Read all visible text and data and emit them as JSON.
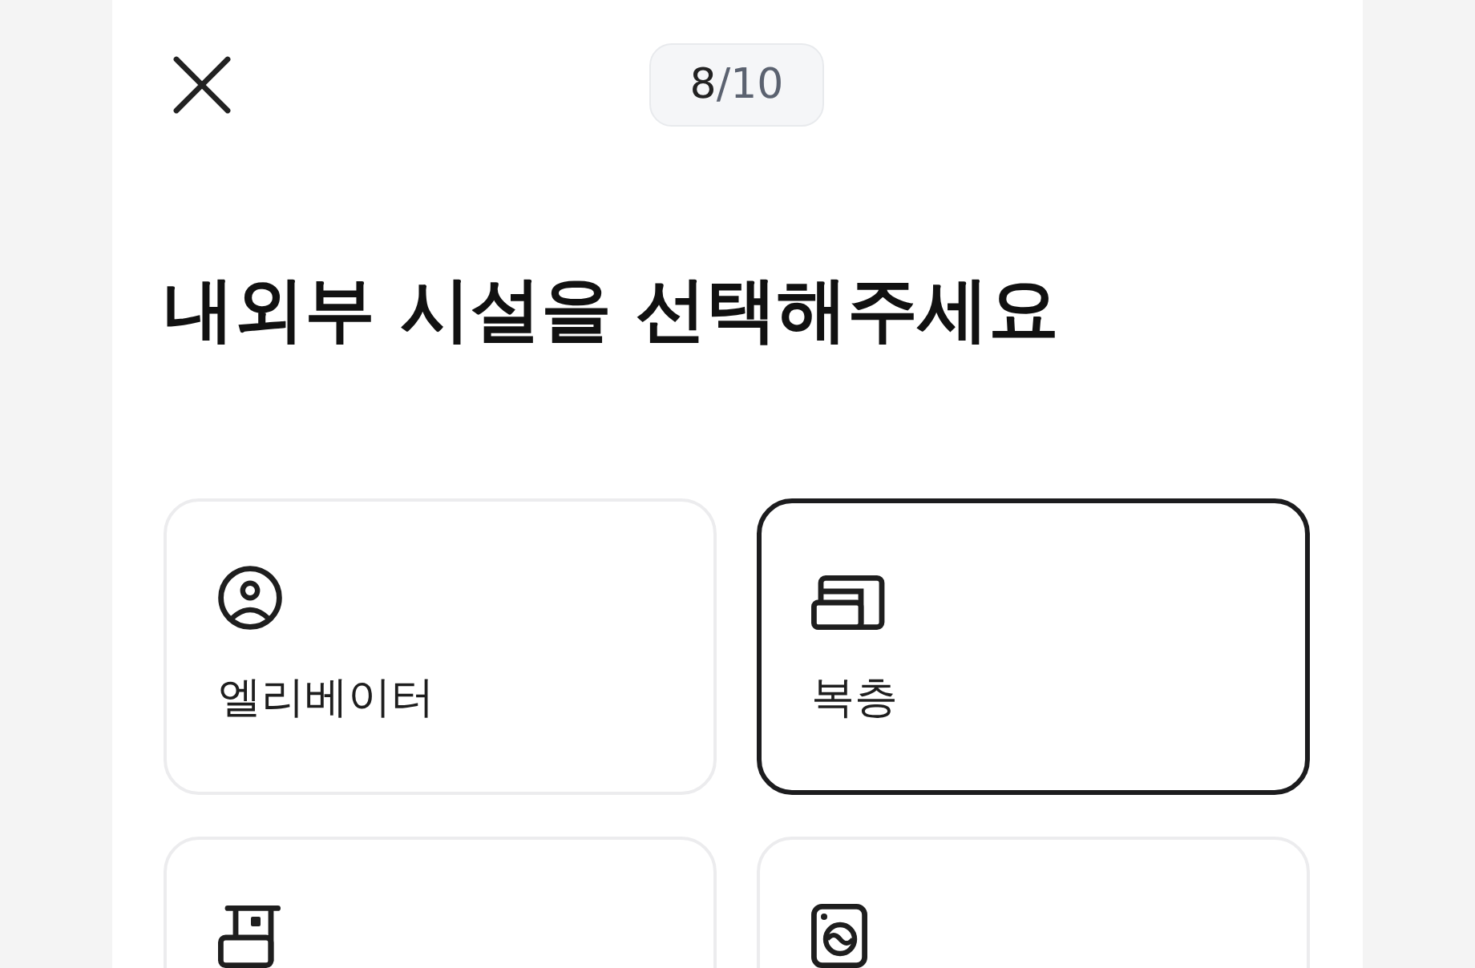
{
  "progress": {
    "current": "8",
    "total": "/10"
  },
  "title": "내외부 시설을 선택해주세요",
  "options": [
    {
      "label": "엘리베이터",
      "selected": false
    },
    {
      "label": "복층",
      "selected": true
    },
    {
      "selected": false
    },
    {
      "selected": false
    }
  ]
}
